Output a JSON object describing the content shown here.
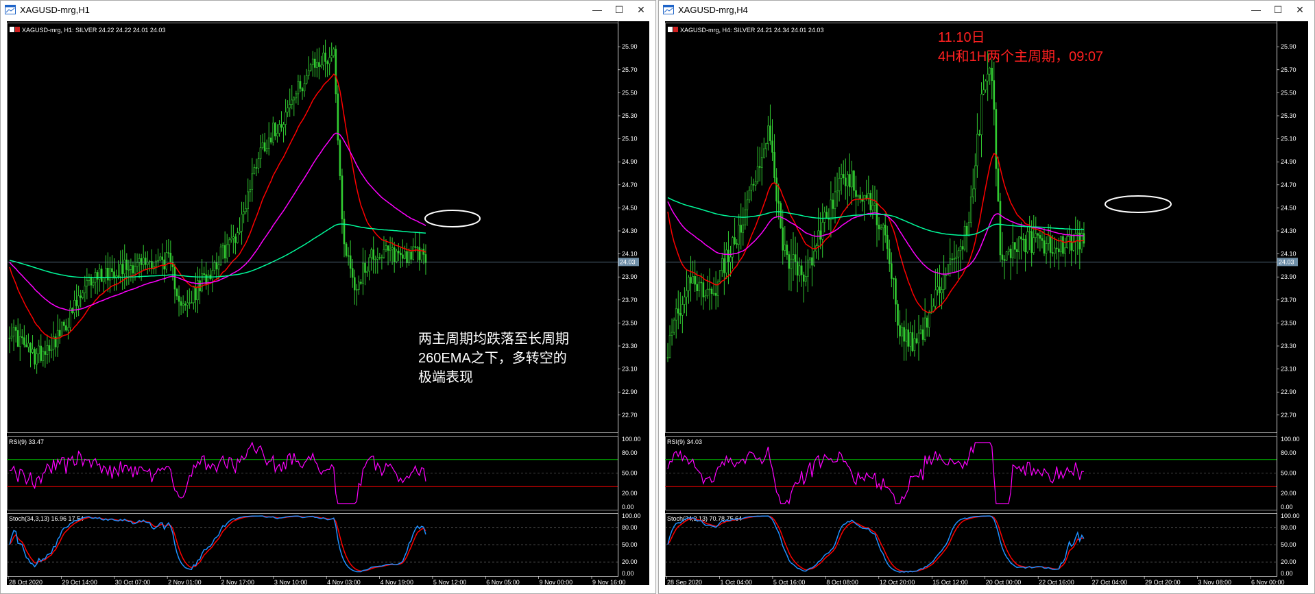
{
  "windows": [
    {
      "title": "XAGUSD-mrg,H1",
      "header_text": "XAGUSD-mrg, H1:  SILVER  24.22 24.22 24.01 24.03",
      "rsi_label": "RSI(9) 33.47",
      "stoch_label": "Stoch(34,3,13) 16.96 17.54",
      "price_ticks": [
        "25.90",
        "25.70",
        "25.50",
        "25.30",
        "25.10",
        "24.90",
        "24.70",
        "24.50",
        "24.30",
        "24.10",
        "23.90",
        "23.70",
        "23.50",
        "23.30",
        "23.10",
        "22.90",
        "22.70"
      ],
      "current_price": "24.03",
      "rsi_ticks": [
        "100.00",
        "80.00",
        "50.00",
        "20.00",
        "0.00"
      ],
      "stoch_ticks": [
        "100.00",
        "80.00",
        "50.00",
        "20.00",
        "0.00"
      ],
      "time_ticks": [
        "28 Oct 2020",
        "29 Oct 14:00",
        "30 Oct 07:00",
        "2 Nov 01:00",
        "2 Nov 17:00",
        "3 Nov 10:00",
        "4 Nov 03:00",
        "4 Nov 19:00",
        "5 Nov 12:00",
        "6 Nov 05:00",
        "9 Nov 00:00",
        "9 Nov 16:00"
      ],
      "annotation_lines": [
        "两主周期均跌落至长周期",
        "260EMA之下，多转空的",
        "极端表现"
      ]
    },
    {
      "title": "XAGUSD-mrg,H4",
      "header_text": "XAGUSD-mrg, H4:  SILVER  24.21 24.34 24.01 24.03",
      "rsi_label": "RSI(9) 34.03",
      "stoch_label": "Stoch(34,3,13) 70.78 75.64",
      "price_ticks": [
        "25.90",
        "25.70",
        "25.50",
        "25.30",
        "25.10",
        "24.90",
        "24.70",
        "24.50",
        "24.30",
        "24.10",
        "23.90",
        "23.70",
        "23.50",
        "23.30",
        "23.10",
        "22.90",
        "22.70"
      ],
      "current_price": "24.03",
      "rsi_ticks": [
        "100.00",
        "80.00",
        "50.00",
        "20.00",
        "0.00"
      ],
      "stoch_ticks": [
        "100.00",
        "80.00",
        "50.00",
        "20.00",
        "0.00"
      ],
      "time_ticks": [
        "28 Sep 2020",
        "1 Oct 04:00",
        "5 Oct 16:00",
        "8 Oct 08:00",
        "12 Oct 20:00",
        "15 Oct 12:00",
        "20 Oct 00:00",
        "22 Oct 16:00",
        "27 Oct 04:00",
        "29 Oct 20:00",
        "3 Nov 08:00",
        "6 Nov 00:00"
      ],
      "annotation_lines": [
        "11.10日",
        "4H和1H两个主周期，09:07"
      ]
    }
  ],
  "colors": {
    "candles": "#32cd32",
    "ema_red": "#ff0000",
    "ema_magenta": "#ff00ff",
    "ema_green": "#00fa9a",
    "rsi_line": "#ff00ff",
    "stoch_main": "#1e90ff",
    "stoch_signal": "#ff0000",
    "annotation_left": "#ffffff",
    "annotation_right": "#ff2020"
  },
  "icons": {
    "minimize": "minimize-icon",
    "maximize": "maximize-icon",
    "close": "close-icon"
  }
}
